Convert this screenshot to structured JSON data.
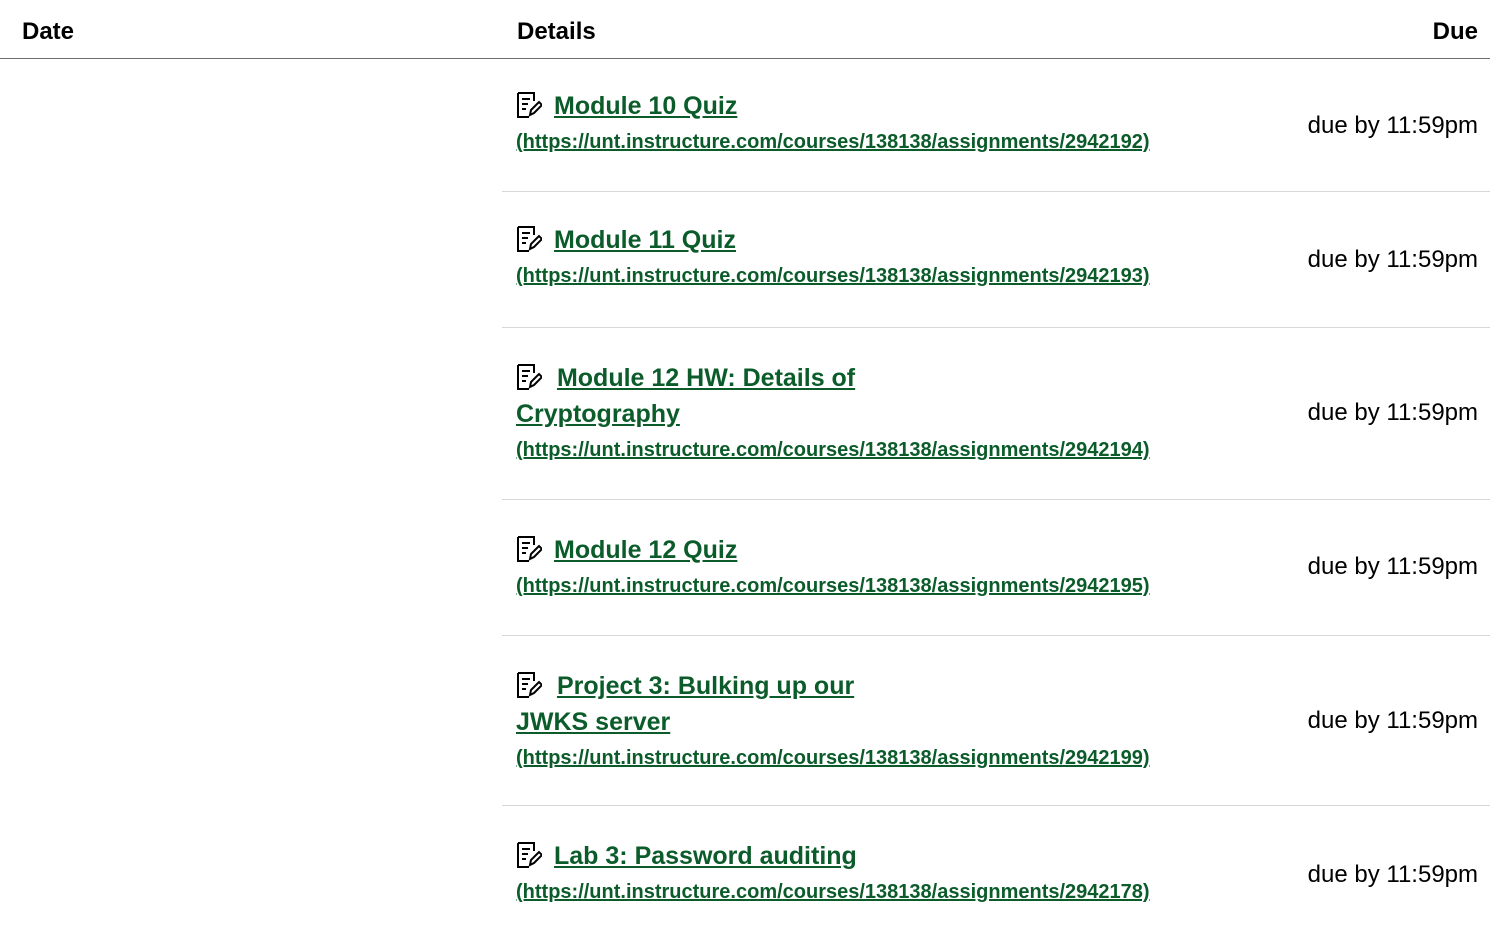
{
  "header": {
    "date": "Date",
    "details": "Details",
    "due": "Due"
  },
  "rows": [
    {
      "icon": "assignment-icon",
      "title": "Module 10 Quiz",
      "url": "(https://unt.instructure.com/courses/138138/assignments/2942192)",
      "due": "due by 11:59pm"
    },
    {
      "icon": "assignment-icon",
      "title": "Module 11 Quiz",
      "url": "(https://unt.instructure.com/courses/138138/assignments/2942193)",
      "due": "due by 11:59pm"
    },
    {
      "icon": "assignment-icon",
      "title": "Module 12 HW: Details of Cryptography",
      "url": "(https://unt.instructure.com/courses/138138/assignments/2942194)",
      "due": "due by 11:59pm"
    },
    {
      "icon": "assignment-icon",
      "title": "Module 12 Quiz",
      "url": "(https://unt.instructure.com/courses/138138/assignments/2942195)",
      "due": "due by 11:59pm"
    },
    {
      "icon": "assignment-icon",
      "title": "Project 3: Bulking up our JWKS server",
      "url": "(https://unt.instructure.com/courses/138138/assignments/2942199)",
      "due": "due by 11:59pm"
    },
    {
      "icon": "assignment-icon",
      "title": "Lab 3: Password auditing",
      "url": "(https://unt.instructure.com/courses/138138/assignments/2942178)",
      "due": "due by 11:59pm"
    }
  ]
}
